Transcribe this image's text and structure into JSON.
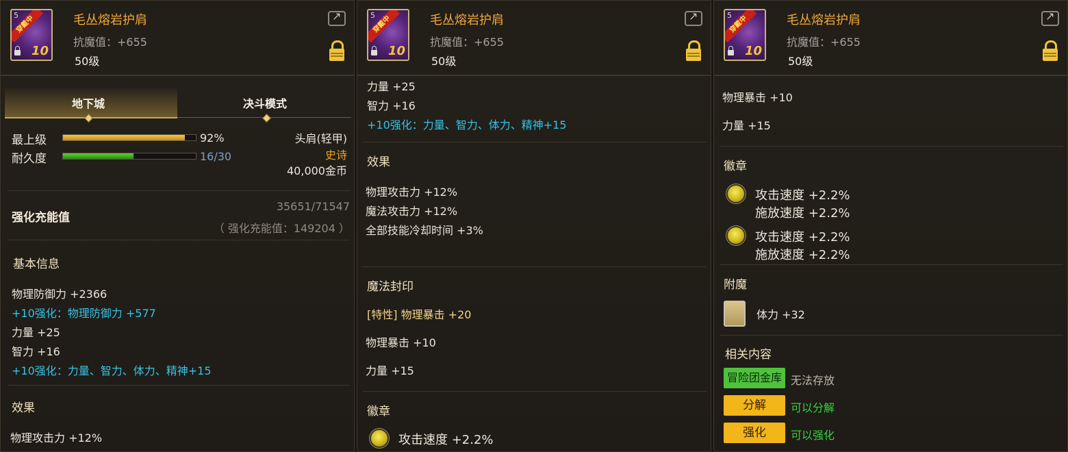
{
  "item": {
    "name": "毛丛熔岩护肩",
    "anti_magic": "抗魔值：+655",
    "level": "50级",
    "icon_level": "5",
    "icon_ribbon": "穿戴中",
    "icon_plus": "10"
  },
  "panel1": {
    "tabs": [
      "地下城",
      "决斗模式"
    ],
    "grade_label": "最上级",
    "grade_value": "92%",
    "grade_fraction": 0.92,
    "durability_label": "耐久度",
    "durability_value": "16/30",
    "durability_fraction": 0.5333,
    "slot_type": "头肩(轻甲)",
    "rarity": "史诗",
    "price": "40,000金币",
    "charge_label": "强化充能值",
    "charge_value": "35651/71547",
    "charge_total": "（ 强化充能值：149204 ）",
    "basic_info_title": "基本信息",
    "basic_lines": [
      "物理防御力 +2366",
      "+10强化：物理防御力 +577",
      "力量 +25",
      "智力 +16",
      "+10强化：力量、智力、体力、精神+15"
    ],
    "effect_title": "效果",
    "effect_line": "物理攻击力 +12%"
  },
  "panel2": {
    "lines_top": [
      "力量 +25",
      "智力 +16",
      "+10强化：力量、智力、体力、精神+15"
    ],
    "effect_title": "效果",
    "effects": [
      "物理攻击力 +12%",
      "魔法攻击力 +12%",
      "全部技能冷却时间 +3%"
    ],
    "seal_title": "魔法封印",
    "seal_lines": [
      "[特性] 物理暴击 +20",
      "物理暴击 +10",
      "力量 +15"
    ],
    "emblem_title": "徽章",
    "emblem_line": "攻击速度 +2.2%"
  },
  "panel3": {
    "lines_top": [
      "物理暴击 +10",
      "力量 +15"
    ],
    "emblem_title": "徽章",
    "emblems": [
      {
        "a": "攻击速度 +2.2%",
        "b": "施放速度 +2.2%"
      },
      {
        "a": "攻击速度 +2.2%",
        "b": "施放速度 +2.2%"
      }
    ],
    "enchant_title": "附魔",
    "enchant_line": "体力 +32",
    "related_title": "相关内容",
    "related": [
      {
        "badge": "冒险团金库",
        "text": "无法存放"
      },
      {
        "badge": "分解",
        "text": "可以分解"
      },
      {
        "badge": "强化",
        "text": "可以强化"
      }
    ]
  },
  "colors": {
    "name": "#f0a83a",
    "cyan": "#35c2e4",
    "rarity": "#f0a020",
    "badge_green": "#4fc23c",
    "badge_yellow": "#f2b51a"
  }
}
